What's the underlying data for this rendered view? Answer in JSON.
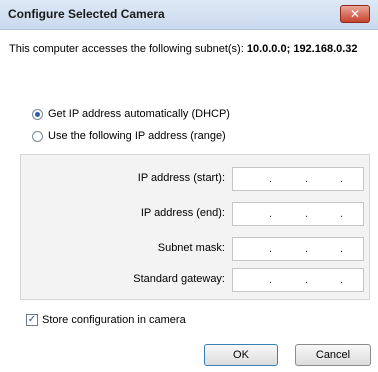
{
  "window": {
    "title": "Configure Selected Camera",
    "close_glyph": "✕"
  },
  "subnet": {
    "text": "This computer accesses the following subnet(s):",
    "value": "10.0.0.0; 192.168.0.32"
  },
  "mode": {
    "options": [
      {
        "label": "Get IP address automatically (DHCP)",
        "selected": true
      },
      {
        "label": "Use the following IP address (range)",
        "selected": false
      }
    ]
  },
  "fields": [
    {
      "label": "IP address (start):",
      "value": ""
    },
    {
      "label": "IP address (end):",
      "value": ""
    },
    {
      "label": "Subnet mask:",
      "value": ""
    },
    {
      "label": "Standard gateway:",
      "value": ""
    }
  ],
  "ip_separator": ".",
  "store_config": {
    "label": "Store configuration in camera",
    "checked": true,
    "check_glyph": "✓"
  },
  "buttons": {
    "ok": "OK",
    "cancel": "Cancel"
  },
  "icons": {
    "close": "close-icon",
    "check": "checkmark-icon"
  }
}
